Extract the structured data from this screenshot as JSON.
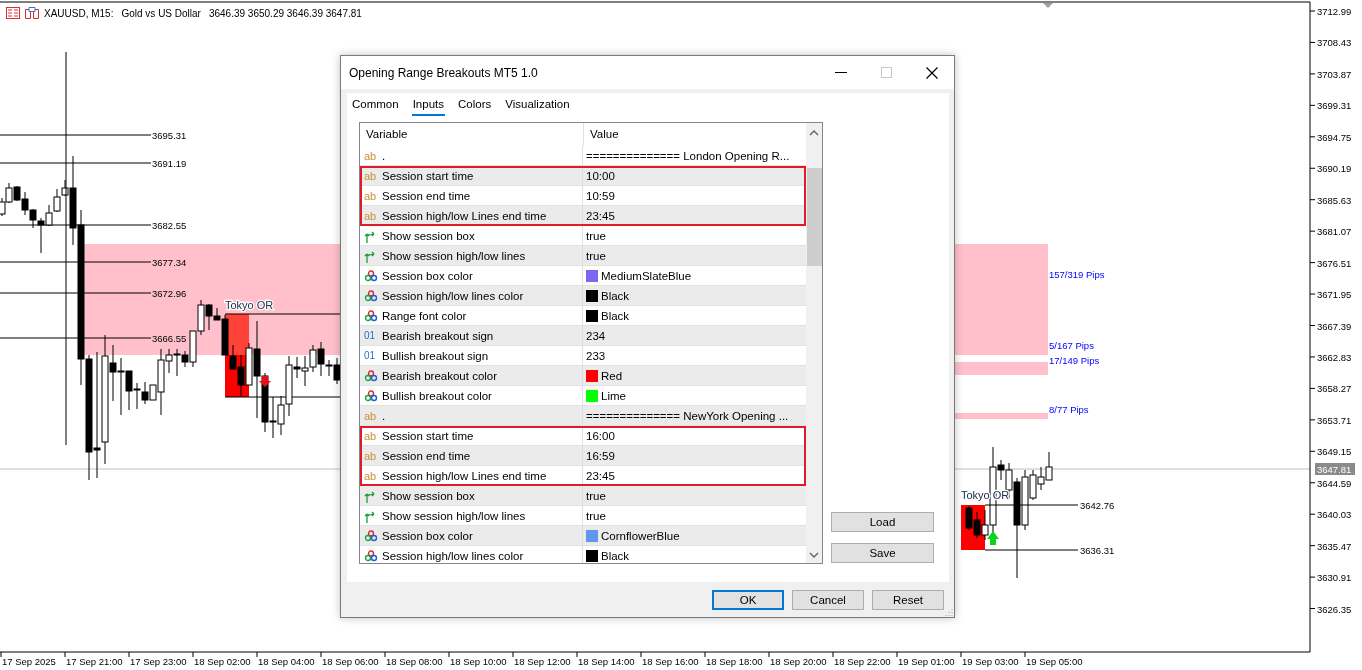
{
  "chart": {
    "header": {
      "symbol": "XAUUSD, M15:",
      "description": "Gold vs US Dollar",
      "prices": "3646.39 3650.29 3646.39 3647.81"
    },
    "price_axis": {
      "labels": [
        "3712.99",
        "3708.43",
        "3703.87",
        "3699.31",
        "3694.75",
        "3690.19",
        "3685.63",
        "3681.07",
        "3676.51",
        "3671.95",
        "3667.39",
        "3662.83",
        "3658.27",
        "3653.71",
        "3649.15",
        "3644.59",
        "3640.03",
        "3635.47",
        "3630.91",
        "3626.35"
      ],
      "current_price": "3647.81"
    },
    "time_axis": {
      "labels": [
        "17 Sep 2025",
        "17 Sep 21:00",
        "17 Sep 23:00",
        "18 Sep 02:00",
        "18 Sep 04:00",
        "18 Sep 06:00",
        "18 Sep 08:00",
        "18 Sep 10:00",
        "18 Sep 12:00",
        "18 Sep 14:00",
        "18 Sep 16:00",
        "18 Sep 18:00",
        "18 Sep 20:00",
        "18 Sep 22:00",
        "19 Sep 01:00",
        "19 Sep 03:00",
        "19 Sep 05:00"
      ]
    },
    "level_labels": [
      "3695.31",
      "3691.19",
      "3682.55",
      "3677.34",
      "3672.96",
      "3666.55"
    ],
    "session_labels": [
      "Tokyo OR",
      "Tokyo OR"
    ],
    "breakout_level_labels": [
      "3642.76",
      "3636.31"
    ],
    "pips_labels": [
      "157/319 Pips",
      "5/167 Pips",
      "17/149 Pips",
      "8/77 Pips"
    ]
  },
  "dialog": {
    "title": "Opening Range Breakouts MT5 1.0",
    "tabs": [
      {
        "label": "Common",
        "selected": false
      },
      {
        "label": "Inputs",
        "selected": true
      },
      {
        "label": "Colors",
        "selected": false
      },
      {
        "label": "Visualization",
        "selected": false
      }
    ],
    "table": {
      "columns": [
        "Variable",
        "Value"
      ],
      "rows": [
        {
          "kind": "string",
          "icon": "ab",
          "name": ".",
          "value": "============== London Opening R...",
          "highlighted": false
        },
        {
          "kind": "string",
          "icon": "ab",
          "name": "Session start time",
          "value": "10:00",
          "highlighted": true
        },
        {
          "kind": "string",
          "icon": "ab",
          "name": "Session end time",
          "value": "10:59",
          "highlighted": true
        },
        {
          "kind": "string",
          "icon": "ab",
          "name": "Session high/low Lines end time",
          "value": "23:45",
          "highlighted": true
        },
        {
          "kind": "bool",
          "name": "Show session box",
          "value": "true",
          "highlighted": false
        },
        {
          "kind": "bool",
          "name": "Show session high/low lines",
          "value": "true",
          "highlighted": false
        },
        {
          "kind": "color",
          "name": "Session box color",
          "value": "MediumSlateBlue",
          "color": "#7b68ee",
          "highlighted": false
        },
        {
          "kind": "color",
          "name": "Session high/low lines color",
          "value": "Black",
          "color": "#000000",
          "highlighted": false
        },
        {
          "kind": "color",
          "name": "Range font color",
          "value": "Black",
          "color": "#000000",
          "highlighted": false
        },
        {
          "kind": "int",
          "icon": "01",
          "name": "Bearish breakout sign",
          "value": "234",
          "highlighted": false
        },
        {
          "kind": "int",
          "icon": "01",
          "name": "Bullish breakout sign",
          "value": "233",
          "highlighted": false
        },
        {
          "kind": "color",
          "name": "Bearish breakout color",
          "value": "Red",
          "color": "#ff0000",
          "highlighted": false
        },
        {
          "kind": "color",
          "name": "Bullish breakout color",
          "value": "Lime",
          "color": "#00ff00",
          "highlighted": false
        },
        {
          "kind": "string",
          "icon": "ab",
          "name": ".",
          "value": "============== NewYork Opening ...",
          "highlighted": false
        },
        {
          "kind": "string",
          "icon": "ab",
          "name": "Session start time",
          "value": "16:00",
          "highlighted": true
        },
        {
          "kind": "string",
          "icon": "ab",
          "name": "Session end time",
          "value": "16:59",
          "highlighted": true
        },
        {
          "kind": "string",
          "icon": "ab",
          "name": "Session high/low Lines end time",
          "value": "23:45",
          "highlighted": true
        },
        {
          "kind": "bool",
          "name": "Show session box",
          "value": "true",
          "highlighted": false
        },
        {
          "kind": "bool",
          "name": "Show session high/low lines",
          "value": "true",
          "highlighted": false
        },
        {
          "kind": "color",
          "name": "Session box color",
          "value": "CornflowerBlue",
          "color": "#6495ed",
          "highlighted": false
        },
        {
          "kind": "color",
          "name": "Session high/low lines color",
          "value": "Black",
          "color": "#000000",
          "highlighted": false
        }
      ]
    },
    "side_buttons": [
      "Load",
      "Save"
    ],
    "buttons": [
      {
        "label": "OK",
        "default": true
      },
      {
        "label": "Cancel",
        "default": false
      },
      {
        "label": "Reset",
        "default": false
      }
    ]
  }
}
